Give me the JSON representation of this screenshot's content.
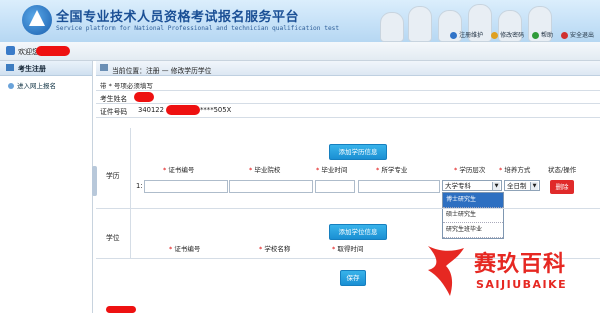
{
  "header": {
    "title": "全国专业技术人员资格考试报名服务平台",
    "subtitle": "Service platform for National Professional and technician qualification test",
    "links": [
      {
        "label": "注册维护",
        "color": "#2f73c8"
      },
      {
        "label": "修改密码",
        "color": "#e0a020"
      },
      {
        "label": "帮助",
        "color": "#2e9b3a"
      },
      {
        "label": "安全退出",
        "color": "#d03030"
      }
    ]
  },
  "welcome": {
    "label": "欢迎您"
  },
  "sidebar": {
    "heading": "考生注册",
    "items": [
      {
        "label": "进入网上报名"
      }
    ]
  },
  "breadcrumb": {
    "text": "当前位置：注册 — 修改学历学位"
  },
  "form": {
    "required_note": "带 * 号项必须填写",
    "name_label": "考生姓名",
    "id_label": "证件号码",
    "id_value_prefix": "340122",
    "id_value_suffix": "****505X",
    "education": {
      "section_label": "学历",
      "add_button": "添加学历信息",
      "columns": [
        "证书编号",
        "毕业院校",
        "毕业时间",
        "所学专业",
        "学历层次",
        "培养方式",
        "状态/操作"
      ],
      "required_marks": [
        "*",
        "*",
        "*",
        "*",
        "*",
        "*",
        ""
      ],
      "row_index": "1:",
      "level_selected": "大学专科",
      "training_selected": "全日制",
      "delete_button": "删除",
      "level_options": [
        "博士研究生",
        "硕士研究生",
        "研究生班毕业"
      ]
    },
    "degree": {
      "section_label": "学位",
      "add_button": "添加学位信息",
      "columns": [
        "证书编号",
        "学校名称",
        "取得时间"
      ],
      "required_marks": [
        "*",
        "*",
        "*"
      ]
    },
    "save_button": "保存"
  },
  "watermark": {
    "cn": "赛玖百科",
    "en": "SAIJIUBAIKE",
    "color": "#e62822"
  }
}
